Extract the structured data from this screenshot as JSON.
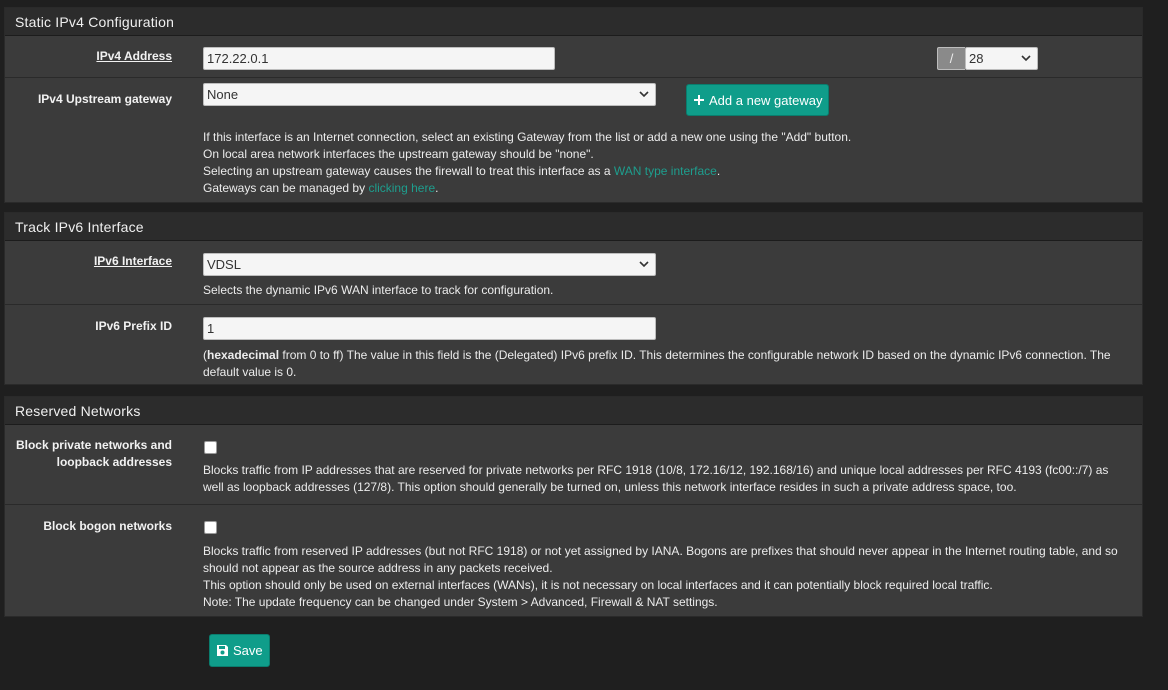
{
  "ipv4": {
    "heading": "Static IPv4 Configuration",
    "address_label": "IPv4 Address",
    "address_value": "172.22.0.1",
    "cidr_separator": "/",
    "cidr_value": "28",
    "gateway_label": "IPv4 Upstream gateway",
    "gateway_value": "None",
    "add_gateway_label": "Add a new gateway",
    "help_line1": "If this interface is an Internet connection, select an existing Gateway from the list or add a new one using the \"Add\" button.",
    "help_line2": "On local area network interfaces the upstream gateway should be \"none\".",
    "help_line3_pre": "Selecting an upstream gateway causes the firewall to treat this interface as a ",
    "help_line3_link": "WAN type interface",
    "help_line3_post": ".",
    "help_line4_pre": "Gateways can be managed by ",
    "help_line4_link": "clicking here",
    "help_line4_post": "."
  },
  "ipv6": {
    "heading": "Track IPv6 Interface",
    "interface_label": "IPv6 Interface",
    "interface_value": "VDSL",
    "interface_help": "Selects the dynamic IPv6 WAN interface to track for configuration.",
    "prefix_label": "IPv6 Prefix ID",
    "prefix_value": "1",
    "prefix_help_bold": "hexadecimal",
    "prefix_help_rest": " from 0 to ff) The value in this field is the (Delegated) IPv6 prefix ID. This determines the configurable network ID based on the dynamic IPv6 connection. The default value is 0.",
    "prefix_help_open": "("
  },
  "reserved": {
    "heading": "Reserved Networks",
    "private_label_line1": "Block private networks and",
    "private_label_line2": "loopback addresses",
    "private_help": "Blocks traffic from IP addresses that are reserved for private networks per RFC 1918 (10/8, 172.16/12, 192.168/16) and unique local addresses per RFC 4193 (fc00::/7) as well as loopback addresses (127/8). This option should generally be turned on, unless this network interface resides in such a private address space, too.",
    "bogon_label": "Block bogon networks",
    "bogon_help_line1": "Blocks traffic from reserved IP addresses (but not RFC 1918) or not yet assigned by IANA. Bogons are prefixes that should never appear in the Internet routing table, and so should not appear as the source address in any packets received.",
    "bogon_help_line2": "This option should only be used on external interfaces (WANs), it is not necessary on local interfaces and it can potentially block required local traffic.",
    "bogon_help_line3": "Note: The update frequency can be changed under System > Advanced, Firewall & NAT settings."
  },
  "save_label": "Save",
  "colors": {
    "accent": "#0f9d8a",
    "link": "#1e9e8e",
    "panel": "#3b3b3b",
    "heading": "#2c2c2c",
    "background": "#1f1f1f"
  }
}
